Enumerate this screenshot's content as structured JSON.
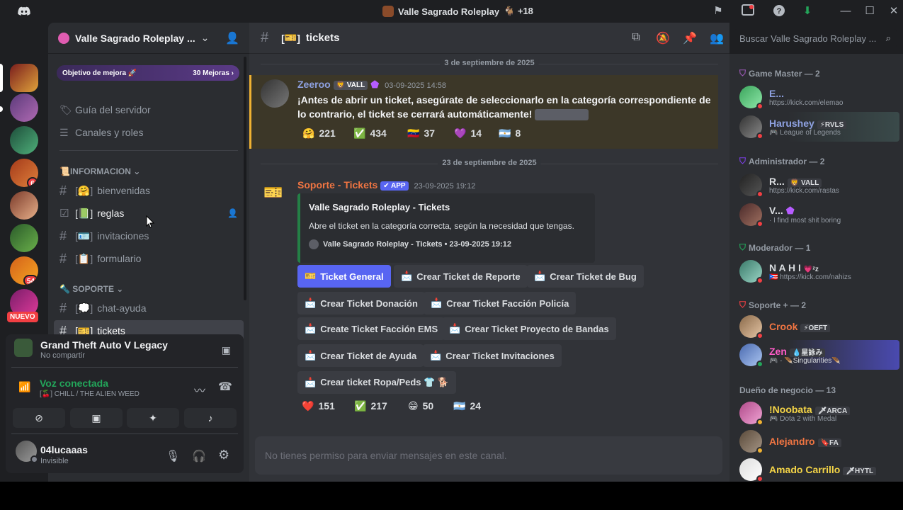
{
  "window": {
    "title": "Valle Sagrado Roleplay",
    "title_suffix": "🐐 +18"
  },
  "server": {
    "name": "Valle Sagrado Roleplay ...",
    "boost_goal": "Objetivo de mejora 🚀",
    "boost_count": "30 Mejoras",
    "rail_badges": [
      "6",
      "54"
    ],
    "new_label": "NUEVO"
  },
  "sidebar": {
    "guide": "Guía del servidor",
    "channels_roles": "Canales y roles",
    "cat_info": "📜INFORMACION",
    "cat_support": "🔦 SOPORTE",
    "channels": [
      {
        "icon": "#",
        "emoji": "🤗",
        "label": "bienvenidas"
      },
      {
        "icon": "☑",
        "emoji": "📗",
        "label": "reglas"
      },
      {
        "icon": "#",
        "emoji": "🪪",
        "label": "invitaciones"
      },
      {
        "icon": "#",
        "emoji": "📋",
        "label": "formulario"
      },
      {
        "icon": "#",
        "emoji": "💭",
        "label": "chat-ayuda"
      },
      {
        "icon": "#",
        "emoji": "🎫",
        "label": "tickets"
      }
    ]
  },
  "activity": {
    "game": "Grand Theft Auto V Legacy",
    "game_sub": "No compartir",
    "voice_status": "Voz conectada",
    "voice_channel": "[🍒] CHILL / THE ALIEN WEED"
  },
  "user": {
    "name": "04lucaaas",
    "status": "Invisible"
  },
  "chat": {
    "channel_emoji": "🎫",
    "channel_name": "tickets",
    "search_placeholder": "Buscar Valle Sagrado Roleplay ...",
    "date1": "3 de septiembre de 2025",
    "date2": "23 de septiembre de 2025",
    "msg1": {
      "author": "Zeeroo",
      "tag": "🦁 VALL",
      "time": "03-09-2025 14:58",
      "text": "¡Antes de abrir un ticket, asegúrate de seleccionarlo en la categoría correspondiente de lo contrario, el ticket se cerrará automáticamente!",
      "reactions": [
        {
          "emoji": "🤗",
          "count": "221"
        },
        {
          "emoji": "✅",
          "count": "434"
        },
        {
          "emoji": "🇻🇪",
          "count": "37"
        },
        {
          "emoji": "💜",
          "count": "14"
        },
        {
          "emoji": "🇦🇷",
          "count": "8"
        }
      ]
    },
    "msg2": {
      "author": "Soporte - Tickets",
      "app_tag": "✔ APP",
      "time": "23-09-2025 19:12",
      "embed_title": "Valle Sagrado Roleplay - Tickets",
      "embed_desc": "Abre el ticket en la categoría correcta, según la necesidad que tengas.",
      "embed_footer": "Valle Sagrado Roleplay - Tickets • 23-09-2025 19:12",
      "buttons": [
        "Ticket General",
        "Crear Ticket de Reporte",
        "Crear Ticket de Bug",
        "Crear Ticket Donación",
        "Crear Ticket Facción Policía",
        "Create Ticket Facción EMS",
        "Crear Ticket Proyecto de Bandas",
        "Crear Ticket de Ayuda",
        "Crear Ticket Invitaciones",
        "Crear ticket Ropa/Peds 👕 🐕"
      ],
      "reactions": [
        {
          "emoji": "❤️",
          "count": "151"
        },
        {
          "emoji": "✅",
          "count": "217"
        },
        {
          "emoji": "😁",
          "count": "50"
        },
        {
          "emoji": "🇦🇷",
          "count": "24"
        }
      ]
    },
    "composer_placeholder": "No tienes permiso para enviar mensajes en este canal."
  },
  "members": {
    "roles": [
      {
        "name": "Game Master — 2",
        "color": "#9b59b6"
      },
      {
        "name": "Administrador — 2",
        "color": "#7b3fe4"
      },
      {
        "name": "Moderador — 1",
        "color": "#23a55a"
      },
      {
        "name": "Soporte + — 2",
        "color": "#f23f43"
      },
      {
        "name": "Dueño de negocio — 13",
        "color": "#949ba4"
      }
    ],
    "list": [
      {
        "name": "E...",
        "sub": "https://kick.com/elemao",
        "color": "#8ea1e1"
      },
      {
        "name": "Harushey",
        "tag": "⚡RVLS",
        "sub": "🎮 League of Legends",
        "color": "#8ea1e1"
      },
      {
        "name": "R...",
        "tag": "🦁 VALL",
        "sub": "https://kick.com/rastas",
        "color": "#dbdee1"
      },
      {
        "name": "V...",
        "sub": "· I find most shit boring",
        "color": "#dbdee1"
      },
      {
        "name": "N A H I",
        "tag": "💗ᶻz",
        "sub": "🇵🇷 https://kick.com/nahizs",
        "color": "#dbdee1"
      },
      {
        "name": "Crook",
        "tag": "⚡OEFT",
        "sub": "",
        "color": "#f07542"
      },
      {
        "name": "Zen",
        "tag": "💧星詠み",
        "sub": "🎮 · 🪶Singularities🪶",
        "color": "#ff5cc8"
      },
      {
        "name": "!Noobata",
        "tag": "🗡ARCA",
        "sub": "🎮 Dota 2 with Medal",
        "color": "#f5d547"
      },
      {
        "name": "Alejandro",
        "tag": "🔖FA",
        "sub": "",
        "color": "#f07542"
      },
      {
        "name": "Amado Carrillo",
        "tag": "🗡HYTL",
        "sub": "",
        "color": "#f5d547"
      }
    ]
  },
  "colors": {
    "accent": "#5865f2",
    "online": "#23a55a",
    "dnd": "#f23f43",
    "highlight": "#f0b232"
  }
}
